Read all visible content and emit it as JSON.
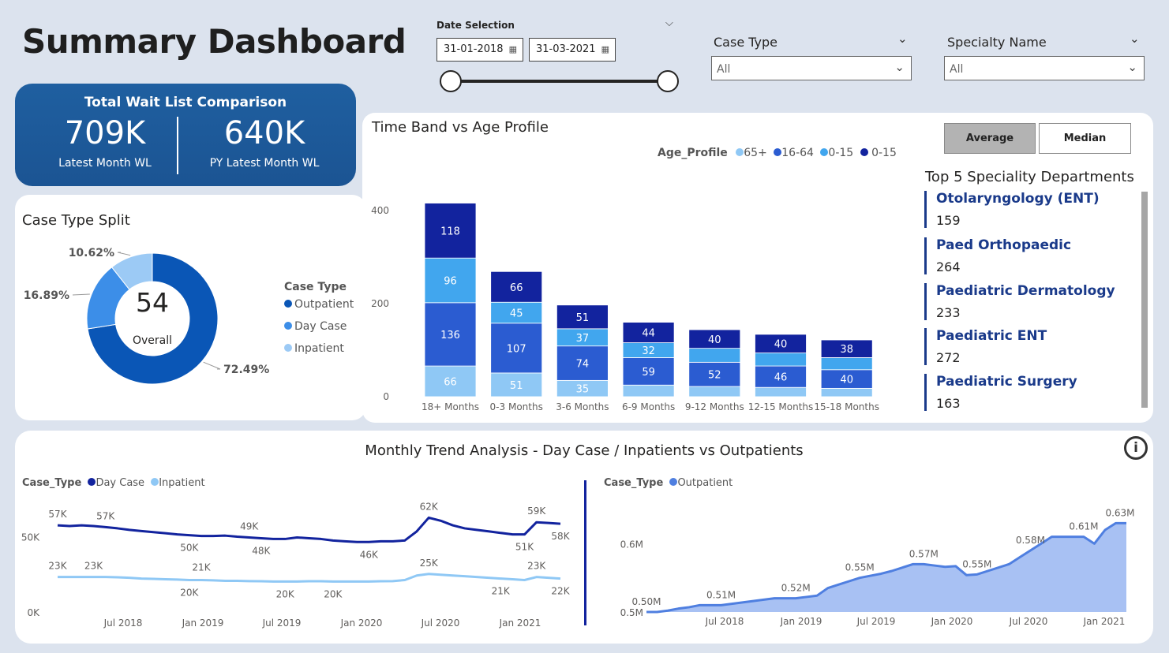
{
  "page_title": "Summary Dashboard",
  "date_selection": {
    "label": "Date Selection",
    "start": "31-01-2018",
    "end": "31-03-2021"
  },
  "case_type_filter": {
    "label": "Case Type",
    "value": "All"
  },
  "specialty_filter": {
    "label": "Specialty Name",
    "value": "All"
  },
  "kpi": {
    "title": "Total Wait List Comparison",
    "latest_value": "709K",
    "latest_label": "Latest Month WL",
    "py_value": "640K",
    "py_label": "PY Latest Month WL"
  },
  "case_type_split": {
    "title": "Case Type Split",
    "center_value": "54",
    "center_label": "Overall",
    "legend_title": "Case Type",
    "legend": [
      "Outpatient",
      "Day Case",
      "Inpatient"
    ],
    "labels": [
      "72.49%",
      "16.89%",
      "10.62%"
    ]
  },
  "time_band": {
    "title": "Time Band vs Age Profile",
    "legend_title": "Age_Profile",
    "legend": [
      "65+",
      "16-64",
      "0-15",
      "0-15"
    ]
  },
  "toggle": {
    "average": "Average",
    "median": "Median"
  },
  "top5": {
    "title": "Top 5 Speciality Departments",
    "items": [
      {
        "name": "Otolaryngology (ENT)",
        "value": "159"
      },
      {
        "name": "Paed Orthopaedic",
        "value": "264"
      },
      {
        "name": "Paediatric Dermatology",
        "value": "233"
      },
      {
        "name": "Paediatric ENT",
        "value": "272"
      },
      {
        "name": "Paediatric Surgery",
        "value": "163"
      }
    ]
  },
  "trend": {
    "title": "Monthly Trend Analysis - Day Case / Inpatients vs Outpatients",
    "left_legend_title": "Case_Type",
    "left_legend": [
      "Day Case",
      "Inpatient"
    ],
    "right_legend_title": "Case_Type",
    "right_legend": [
      "Outpatient"
    ]
  },
  "colors": {
    "navy": "#12239e",
    "blue": "#2b5cd1",
    "sky": "#41a6ee",
    "light": "#8fc8f5",
    "outpatient": "#0a56b6",
    "daycase": "#3c8ee8",
    "inpatient": "#9ccaf5",
    "area": "#a8c1f3",
    "area_line": "#4f7fe0"
  },
  "chart_data": [
    {
      "type": "pie",
      "title": "Case Type Split",
      "categories": [
        "Outpatient",
        "Day Case",
        "Inpatient"
      ],
      "values": [
        72.49,
        16.89,
        10.62
      ]
    },
    {
      "type": "bar",
      "title": "Time Band vs Age Profile",
      "categories": [
        "18+ Months",
        "0-3 Months",
        "3-6 Months",
        "6-9 Months",
        "9-12 Months",
        "12-15 Months",
        "15-18 Months"
      ],
      "ylim": [
        0,
        400
      ],
      "yticks": [
        "0",
        "200",
        "400"
      ],
      "series": [
        {
          "name": "65+",
          "values": [
            66,
            51,
            35,
            25,
            22,
            20,
            18
          ],
          "labels": [
            "66",
            "51",
            "35",
            "",
            "",
            "",
            ""
          ]
        },
        {
          "name": "16-64",
          "values": [
            136,
            107,
            74,
            59,
            52,
            46,
            40
          ],
          "labels": [
            "136",
            "107",
            "74",
            "59",
            "52",
            "46",
            "40"
          ]
        },
        {
          "name": "0-15",
          "values": [
            96,
            45,
            37,
            32,
            30,
            28,
            26
          ],
          "labels": [
            "96",
            "45",
            "37",
            "32",
            "",
            "",
            ""
          ]
        },
        {
          "name": "0-15",
          "values": [
            118,
            66,
            51,
            44,
            40,
            40,
            38
          ],
          "labels": [
            "118",
            "66",
            "51",
            "44",
            "40",
            "40",
            "38"
          ]
        }
      ]
    },
    {
      "type": "line",
      "title": "Day Case / Inpatient",
      "x_ticks": [
        "Jul 2018",
        "Jan 2019",
        "Jul 2019",
        "Jan 2020",
        "Jul 2020",
        "Jan 2021"
      ],
      "y_ticks": [
        "0K",
        "50K"
      ],
      "ylim": [
        0,
        70
      ],
      "series": [
        {
          "name": "Day Case",
          "values": [
            57,
            56.5,
            57,
            56.5,
            55.8,
            55,
            54,
            53.2,
            52.5,
            51.8,
            51,
            50.5,
            50,
            50,
            50.2,
            49.5,
            49,
            48.5,
            48,
            48,
            49,
            48.5,
            48,
            47,
            46.5,
            46,
            46,
            46.5,
            46.5,
            47,
            53,
            62,
            60,
            57,
            55,
            54,
            53,
            52,
            51,
            51,
            59,
            58.5,
            58
          ]
        },
        {
          "name": "Inpatient",
          "values": [
            23,
            23,
            23,
            23,
            23,
            22.8,
            22.5,
            22,
            21.8,
            21.5,
            21.3,
            21,
            21,
            20.8,
            20.5,
            20.5,
            20.3,
            20.2,
            20,
            20,
            20,
            20.2,
            20.2,
            20,
            20,
            20,
            20,
            20.2,
            20.3,
            21,
            24,
            25,
            24.5,
            24,
            23.5,
            23,
            22.5,
            22,
            21.5,
            21,
            23,
            22.5,
            22
          ]
        }
      ],
      "point_labels": [
        {
          "series": "Day Case",
          "index": 0,
          "text": "57K"
        },
        {
          "series": "Day Case",
          "index": 4,
          "text": "57K"
        },
        {
          "series": "Day Case",
          "index": 16,
          "text": "49K"
        },
        {
          "series": "Day Case",
          "index": 11,
          "text": "50K"
        },
        {
          "series": "Day Case",
          "index": 17,
          "text": "48K"
        },
        {
          "series": "Day Case",
          "index": 26,
          "text": "46K"
        },
        {
          "series": "Day Case",
          "index": 31,
          "text": "62K"
        },
        {
          "series": "Day Case",
          "index": 39,
          "text": "51K"
        },
        {
          "series": "Day Case",
          "index": 40,
          "text": "59K"
        },
        {
          "series": "Day Case",
          "index": 42,
          "text": "58K"
        },
        {
          "series": "Inpatient",
          "index": 0,
          "text": "23K"
        },
        {
          "series": "Inpatient",
          "index": 3,
          "text": "23K"
        },
        {
          "series": "Inpatient",
          "index": 12,
          "text": "21K"
        },
        {
          "series": "Inpatient",
          "index": 11,
          "text": "20K"
        },
        {
          "series": "Inpatient",
          "index": 19,
          "text": "20K"
        },
        {
          "series": "Inpatient",
          "index": 23,
          "text": "20K"
        },
        {
          "series": "Inpatient",
          "index": 31,
          "text": "25K"
        },
        {
          "series": "Inpatient",
          "index": 37,
          "text": "21K"
        },
        {
          "series": "Inpatient",
          "index": 40,
          "text": "23K"
        },
        {
          "series": "Inpatient",
          "index": 42,
          "text": "22K"
        }
      ]
    },
    {
      "type": "area",
      "title": "Outpatient",
      "x_ticks": [
        "Jul 2018",
        "Jan 2019",
        "Jul 2019",
        "Jan 2020",
        "Jul 2020",
        "Jan 2021"
      ],
      "y_ticks": [
        "0.5M",
        "0.6M"
      ],
      "ylim": [
        0.5,
        0.65
      ],
      "series": [
        {
          "name": "Outpatient",
          "values": [
            0.5,
            0.5,
            0.502,
            0.505,
            0.507,
            0.51,
            0.51,
            0.51,
            0.512,
            0.514,
            0.516,
            0.518,
            0.52,
            0.52,
            0.52,
            0.522,
            0.524,
            0.535,
            0.54,
            0.545,
            0.55,
            0.553,
            0.556,
            0.56,
            0.565,
            0.57,
            0.57,
            0.568,
            0.566,
            0.567,
            0.554,
            0.555,
            0.56,
            0.565,
            0.57,
            0.58,
            0.59,
            0.6,
            0.61,
            0.61,
            0.61,
            0.61,
            0.6,
            0.62,
            0.63,
            0.63
          ]
        }
      ],
      "point_labels": [
        {
          "index": 0,
          "text": "0.50M"
        },
        {
          "index": 7,
          "text": "0.51M"
        },
        {
          "index": 14,
          "text": "0.52M"
        },
        {
          "index": 20,
          "text": "0.55M"
        },
        {
          "index": 26,
          "text": "0.57M"
        },
        {
          "index": 31,
          "text": "0.55M"
        },
        {
          "index": 36,
          "text": "0.58M"
        },
        {
          "index": 41,
          "text": "0.61M"
        },
        {
          "index": 45,
          "text": "0.63M"
        }
      ]
    }
  ]
}
